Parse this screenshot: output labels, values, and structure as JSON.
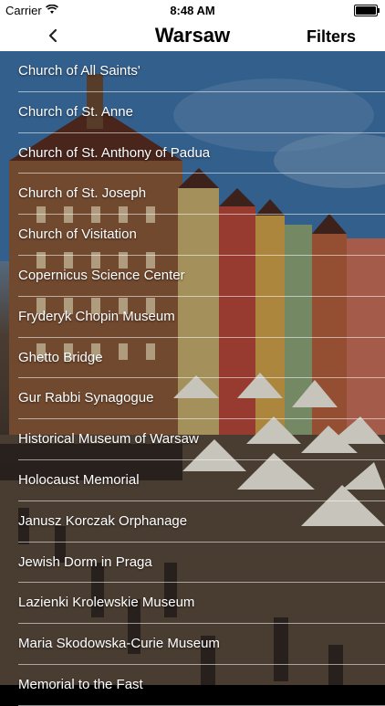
{
  "status_bar": {
    "carrier": "Carrier",
    "time": "8:48 AM",
    "wifi_icon": "wifi-icon",
    "battery_icon": "battery-icon"
  },
  "nav": {
    "back_icon": "chevron-left-icon",
    "title": "Warsaw",
    "filters_label": "Filters"
  },
  "places": [
    {
      "label": "Church of All Saints'"
    },
    {
      "label": "Church of St. Anne"
    },
    {
      "label": "Church of St. Anthony of Padua"
    },
    {
      "label": "Church of St. Joseph"
    },
    {
      "label": "Church of Visitation"
    },
    {
      "label": "Copernicus Science Center"
    },
    {
      "label": "Fryderyk Chopin Museum"
    },
    {
      "label": "Ghetto Bridge"
    },
    {
      "label": "Gur Rabbi Synagogue"
    },
    {
      "label": "Historical Museum of Warsaw"
    },
    {
      "label": "Holocaust Memorial"
    },
    {
      "label": "Janusz Korczak Orphanage"
    },
    {
      "label": "Jewish Dorm in Praga"
    },
    {
      "label": "Lazienki Krolewskie Museum"
    },
    {
      "label": "Maria Skodowska-Curie Museum"
    },
    {
      "label": "Memorial to the Fast"
    }
  ]
}
